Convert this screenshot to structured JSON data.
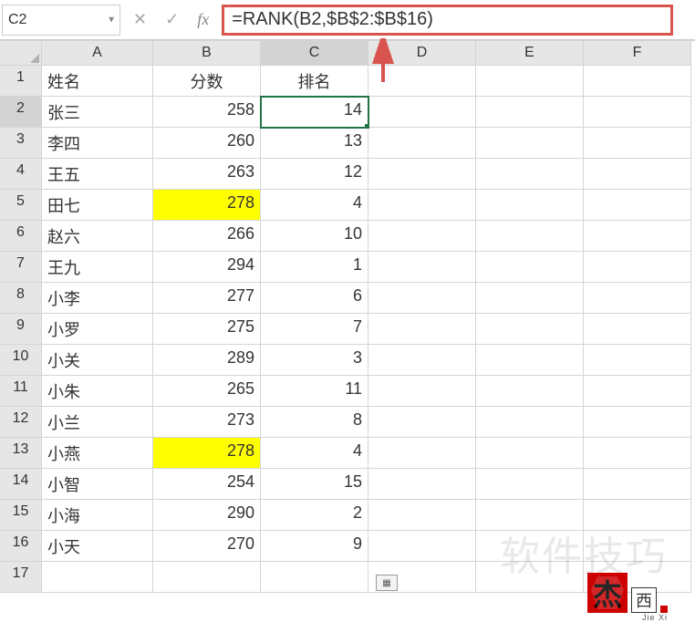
{
  "formula_bar": {
    "name_box": "C2",
    "formula": "=RANK(B2,$B$2:$B$16)"
  },
  "columns": [
    "A",
    "B",
    "C",
    "D",
    "E",
    "F"
  ],
  "headers": {
    "A": "姓名",
    "B": "分数",
    "C": "排名"
  },
  "rows": [
    {
      "n": 1,
      "a": "姓名",
      "b": "分数",
      "c": "排名",
      "header": true
    },
    {
      "n": 2,
      "a": "张三",
      "b": 258,
      "c": 14,
      "selected": true
    },
    {
      "n": 3,
      "a": "李四",
      "b": 260,
      "c": 13
    },
    {
      "n": 4,
      "a": "王五",
      "b": 263,
      "c": 12
    },
    {
      "n": 5,
      "a": "田七",
      "b": 278,
      "c": 4,
      "hl": true
    },
    {
      "n": 6,
      "a": "赵六",
      "b": 266,
      "c": 10
    },
    {
      "n": 7,
      "a": "王九",
      "b": 294,
      "c": 1
    },
    {
      "n": 8,
      "a": "小李",
      "b": 277,
      "c": 6
    },
    {
      "n": 9,
      "a": "小罗",
      "b": 275,
      "c": 7
    },
    {
      "n": 10,
      "a": "小关",
      "b": 289,
      "c": 3
    },
    {
      "n": 11,
      "a": "小朱",
      "b": 265,
      "c": 11
    },
    {
      "n": 12,
      "a": "小兰",
      "b": 273,
      "c": 8
    },
    {
      "n": 13,
      "a": "小燕",
      "b": 278,
      "c": 4,
      "hl": true
    },
    {
      "n": 14,
      "a": "小智",
      "b": 254,
      "c": 15
    },
    {
      "n": 15,
      "a": "小海",
      "b": 290,
      "c": 2
    },
    {
      "n": 16,
      "a": "小天",
      "b": 270,
      "c": 9
    },
    {
      "n": 17,
      "a": "",
      "b": "",
      "c": ""
    }
  ],
  "watermark": "软件技巧",
  "logo": {
    "big": "杰",
    "small": "西",
    "caption": "Jie Xi"
  },
  "chart_data": {
    "type": "table",
    "title": "",
    "columns": [
      "姓名",
      "分数",
      "排名"
    ],
    "data": [
      [
        "张三",
        258,
        14
      ],
      [
        "李四",
        260,
        13
      ],
      [
        "王五",
        263,
        12
      ],
      [
        "田七",
        278,
        4
      ],
      [
        "赵六",
        266,
        10
      ],
      [
        "王九",
        294,
        1
      ],
      [
        "小李",
        277,
        6
      ],
      [
        "小罗",
        275,
        7
      ],
      [
        "小关",
        289,
        3
      ],
      [
        "小朱",
        265,
        11
      ],
      [
        "小兰",
        273,
        8
      ],
      [
        "小燕",
        278,
        4
      ],
      [
        "小智",
        254,
        15
      ],
      [
        "小海",
        290,
        2
      ],
      [
        "小天",
        270,
        9
      ]
    ]
  }
}
